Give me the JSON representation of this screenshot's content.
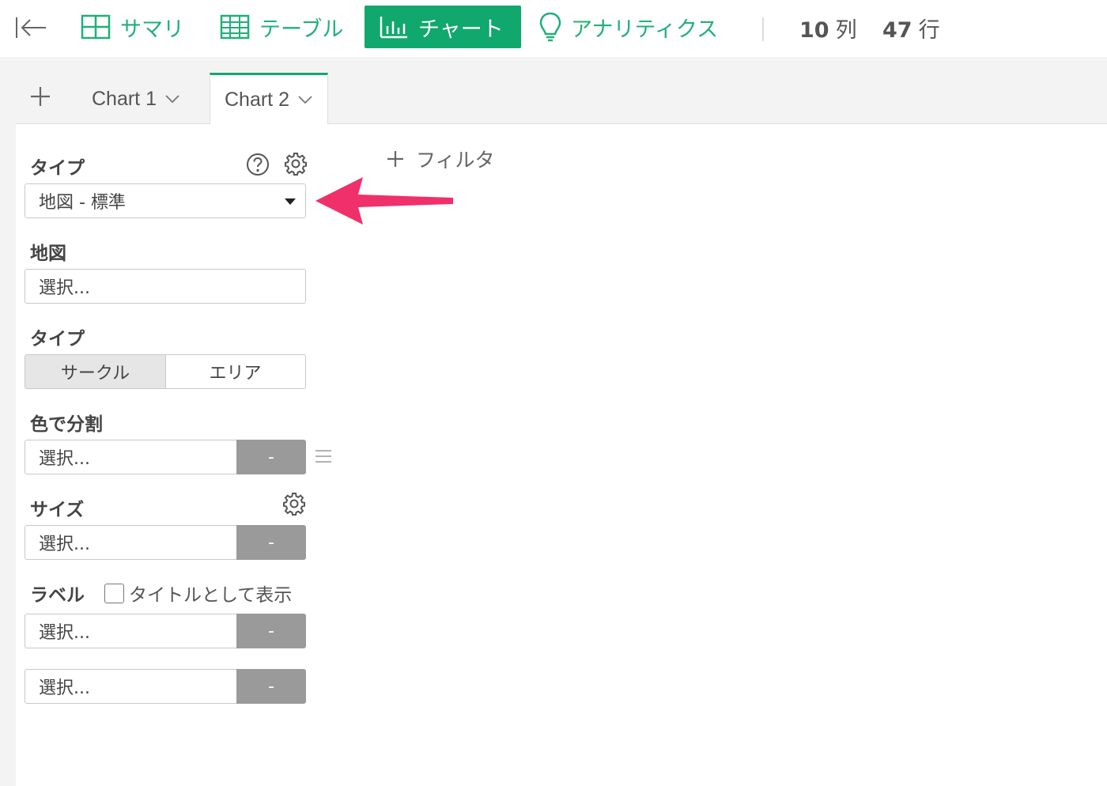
{
  "toolbar": {
    "summary_label": "サマリ",
    "table_label": "テーブル",
    "chart_label": "チャート",
    "analytics_label": "アナリティクス",
    "columns_count": "10",
    "columns_unit": "列",
    "rows_count": "47",
    "rows_unit": "行"
  },
  "tabs": [
    {
      "label": "Chart 1"
    },
    {
      "label": "Chart 2"
    }
  ],
  "filter": {
    "label": "フィルタ"
  },
  "panel": {
    "type_label": "タイプ",
    "type_value": "地図 - 標準",
    "map_label": "地図",
    "map_placeholder": "選択...",
    "subtype_label": "タイプ",
    "subtype_options": [
      "サークル",
      "エリア"
    ],
    "color_label": "色で分割",
    "color_placeholder": "選択...",
    "color_agg": "-",
    "size_label": "サイズ",
    "size_placeholder": "選択...",
    "size_agg": "-",
    "label_label": "ラベル",
    "label_checkbox": "タイトルとして表示",
    "label_placeholder": "選択...",
    "label_agg": "-",
    "extra_placeholder": "選択...",
    "extra_agg": "-"
  },
  "colors": {
    "accent": "#10a86c",
    "arrow": "#f0306a"
  }
}
